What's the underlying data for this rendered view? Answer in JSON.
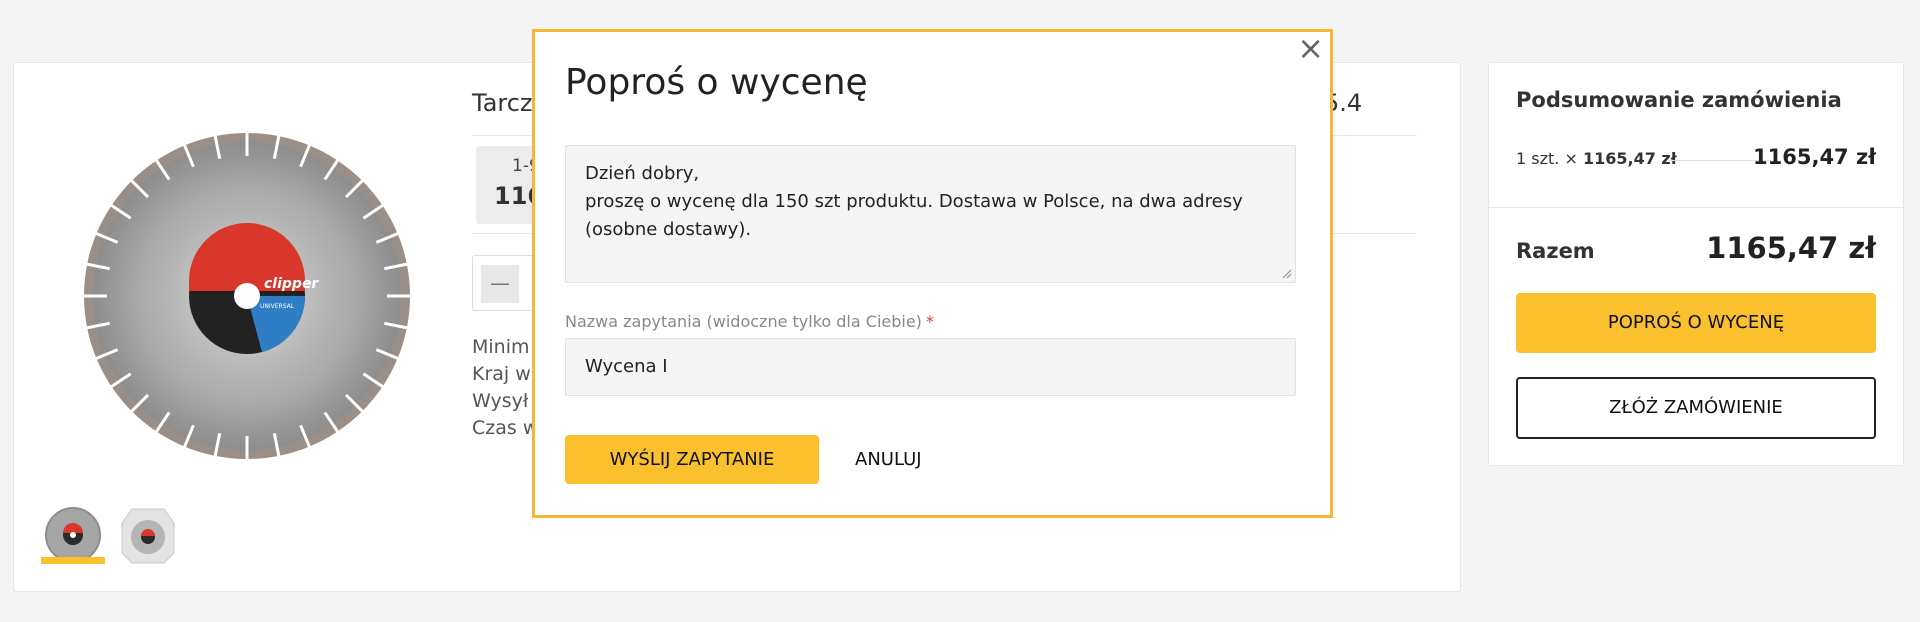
{
  "product": {
    "title_visible": "Tarcz",
    "title_tail": "5.4",
    "price_tier_range": "1-9",
    "price_tier_amount": "116",
    "qty_minus": "—",
    "info_lines": [
      "Minim",
      "Kraj w",
      "Wysył",
      "Czas w"
    ],
    "disc_logo_text": "clipper",
    "disc_type_text": "UNIVERSAL"
  },
  "summary": {
    "title": "Podsumowanie zamówienia",
    "line_qty": "1 szt. ×",
    "line_unit_price": "1165,47 zł",
    "line_total": "1165,47 zł",
    "total_label": "Razem",
    "total_value": "1165,47 zł",
    "quote_button": "POPROŚ O WYCENĘ",
    "order_button": "ZŁÓŻ ZAMÓWIENIE"
  },
  "modal": {
    "close_glyph": "×",
    "title": "Poproś o wycenę",
    "message_lines": [
      "Dzień dobry,",
      "proszę o wycenę dla 150 szt produktu. Dostawa w Polsce, na dwa adresy",
      "(osobne dostawy)."
    ],
    "name_label": "Nazwa zapytania (widoczne tylko dla Ciebie)",
    "required_mark": "*",
    "name_value": "Wycena I",
    "send_button": "WYŚLIJ ZAPYTANIE",
    "cancel_button": "ANULUJ"
  },
  "colors": {
    "accent": "#fbc02d",
    "modal_border": "#f7b731",
    "required": "#e53935"
  }
}
